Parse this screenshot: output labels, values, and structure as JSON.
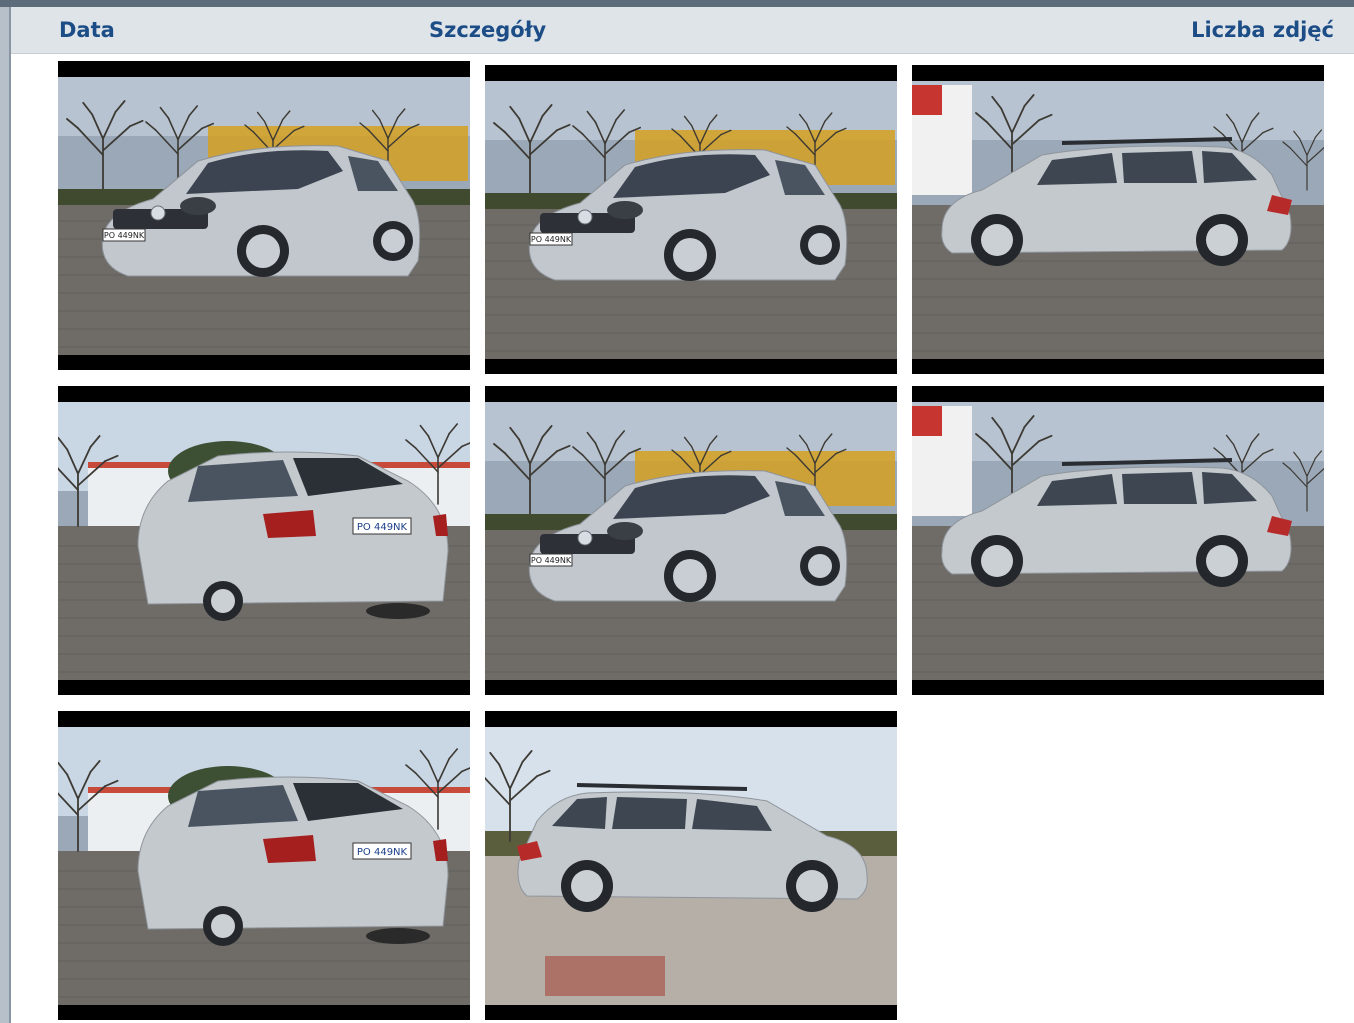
{
  "header": {
    "date_label": "Data",
    "details_label": "Szczegóły",
    "photo_count_label": "Liczba zdjęć"
  },
  "photos": [
    {
      "name": "photo-front-left-1",
      "view": "front-three-quarter-left",
      "plate": "PO 449NK"
    },
    {
      "name": "photo-front-left-2",
      "view": "front-three-quarter-left",
      "plate": "PO 449NK"
    },
    {
      "name": "photo-side-left-1",
      "view": "side-left",
      "plate": ""
    },
    {
      "name": "photo-rear-right-1",
      "view": "rear-three-quarter-right",
      "plate": "PO 449NK"
    },
    {
      "name": "photo-front-left-3",
      "view": "front-three-quarter-left",
      "plate": "PO 449NK"
    },
    {
      "name": "photo-side-left-2",
      "view": "side-left",
      "plate": ""
    },
    {
      "name": "photo-rear-right-2",
      "view": "rear-three-quarter-right",
      "plate": "PO 449NK"
    },
    {
      "name": "photo-side-right-1",
      "view": "side-right",
      "plate": ""
    }
  ],
  "colors": {
    "header_text": "#1c4d86",
    "header_bg": "#dfe4e9",
    "car_body": "#bfc4ca"
  }
}
